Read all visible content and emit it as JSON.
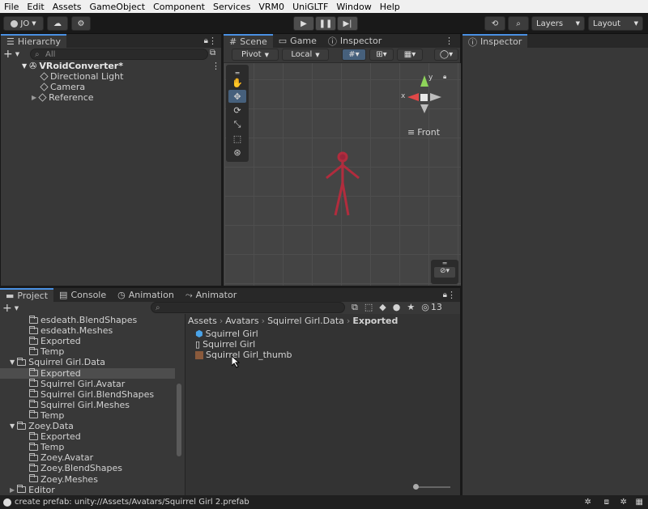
{
  "menu": [
    "File",
    "Edit",
    "Assets",
    "GameObject",
    "Component",
    "Services",
    "VRM0",
    "UniGLTF",
    "Window",
    "Help"
  ],
  "toolbar": {
    "account": "JO",
    "layers": "Layers",
    "layout": "Layout"
  },
  "hierarchy": {
    "tab": "Hierarchy",
    "search_placeholder": "All",
    "root": "VRoidConverter*",
    "items": [
      "Directional Light",
      "Camera",
      "Reference"
    ]
  },
  "scene_tabs": {
    "scene": "Scene",
    "game": "Game",
    "inspector": "Inspector"
  },
  "scene_toolbar": {
    "pivot": "Pivot",
    "local": "Local"
  },
  "gizmo": {
    "x_axis": "x",
    "y_axis": "y",
    "view": "Front"
  },
  "inspector": {
    "tab": "Inspector"
  },
  "bottom_tabs": {
    "project": "Project",
    "console": "Console",
    "animation": "Animation",
    "animator": "Animator"
  },
  "project": {
    "hidden_count": "13",
    "tree": [
      {
        "label": "esdeath.BlendShapes",
        "indent": 3,
        "selected": false
      },
      {
        "label": "esdeath.Meshes",
        "indent": 3,
        "selected": false
      },
      {
        "label": "Exported",
        "indent": 3,
        "selected": false
      },
      {
        "label": "Temp",
        "indent": 3,
        "selected": false
      },
      {
        "label": "Squirrel Girl.Data",
        "indent": 2,
        "selected": false,
        "open": true
      },
      {
        "label": "Exported",
        "indent": 3,
        "selected": true
      },
      {
        "label": "Squirrel Girl.Avatar",
        "indent": 3,
        "selected": false
      },
      {
        "label": "Squirrel Girl.BlendShapes",
        "indent": 3,
        "selected": false
      },
      {
        "label": "Squirrel Girl.Meshes",
        "indent": 3,
        "selected": false
      },
      {
        "label": "Temp",
        "indent": 3,
        "selected": false
      },
      {
        "label": "Zoey.Data",
        "indent": 2,
        "selected": false,
        "open": true
      },
      {
        "label": "Exported",
        "indent": 3,
        "selected": false
      },
      {
        "label": "Temp",
        "indent": 3,
        "selected": false
      },
      {
        "label": "Zoey.Avatar",
        "indent": 3,
        "selected": false
      },
      {
        "label": "Zoey.BlendShapes",
        "indent": 3,
        "selected": false
      },
      {
        "label": "Zoey.Meshes",
        "indent": 3,
        "selected": false
      },
      {
        "label": "Editor",
        "indent": 1,
        "selected": false
      }
    ],
    "breadcrumb": [
      "Assets",
      "Avatars",
      "Squirrel Girl.Data",
      "Exported"
    ],
    "files": [
      {
        "label": "Squirrel Girl",
        "icon": "prefab-icon"
      },
      {
        "label": "Squirrel Girl",
        "icon": "file-icon"
      },
      {
        "label": "Squirrel Girl_thumb",
        "icon": "image-icon"
      }
    ]
  },
  "status": {
    "text": "create prefab: unity://Assets/Avatars/Squirrel Girl 2.prefab"
  }
}
